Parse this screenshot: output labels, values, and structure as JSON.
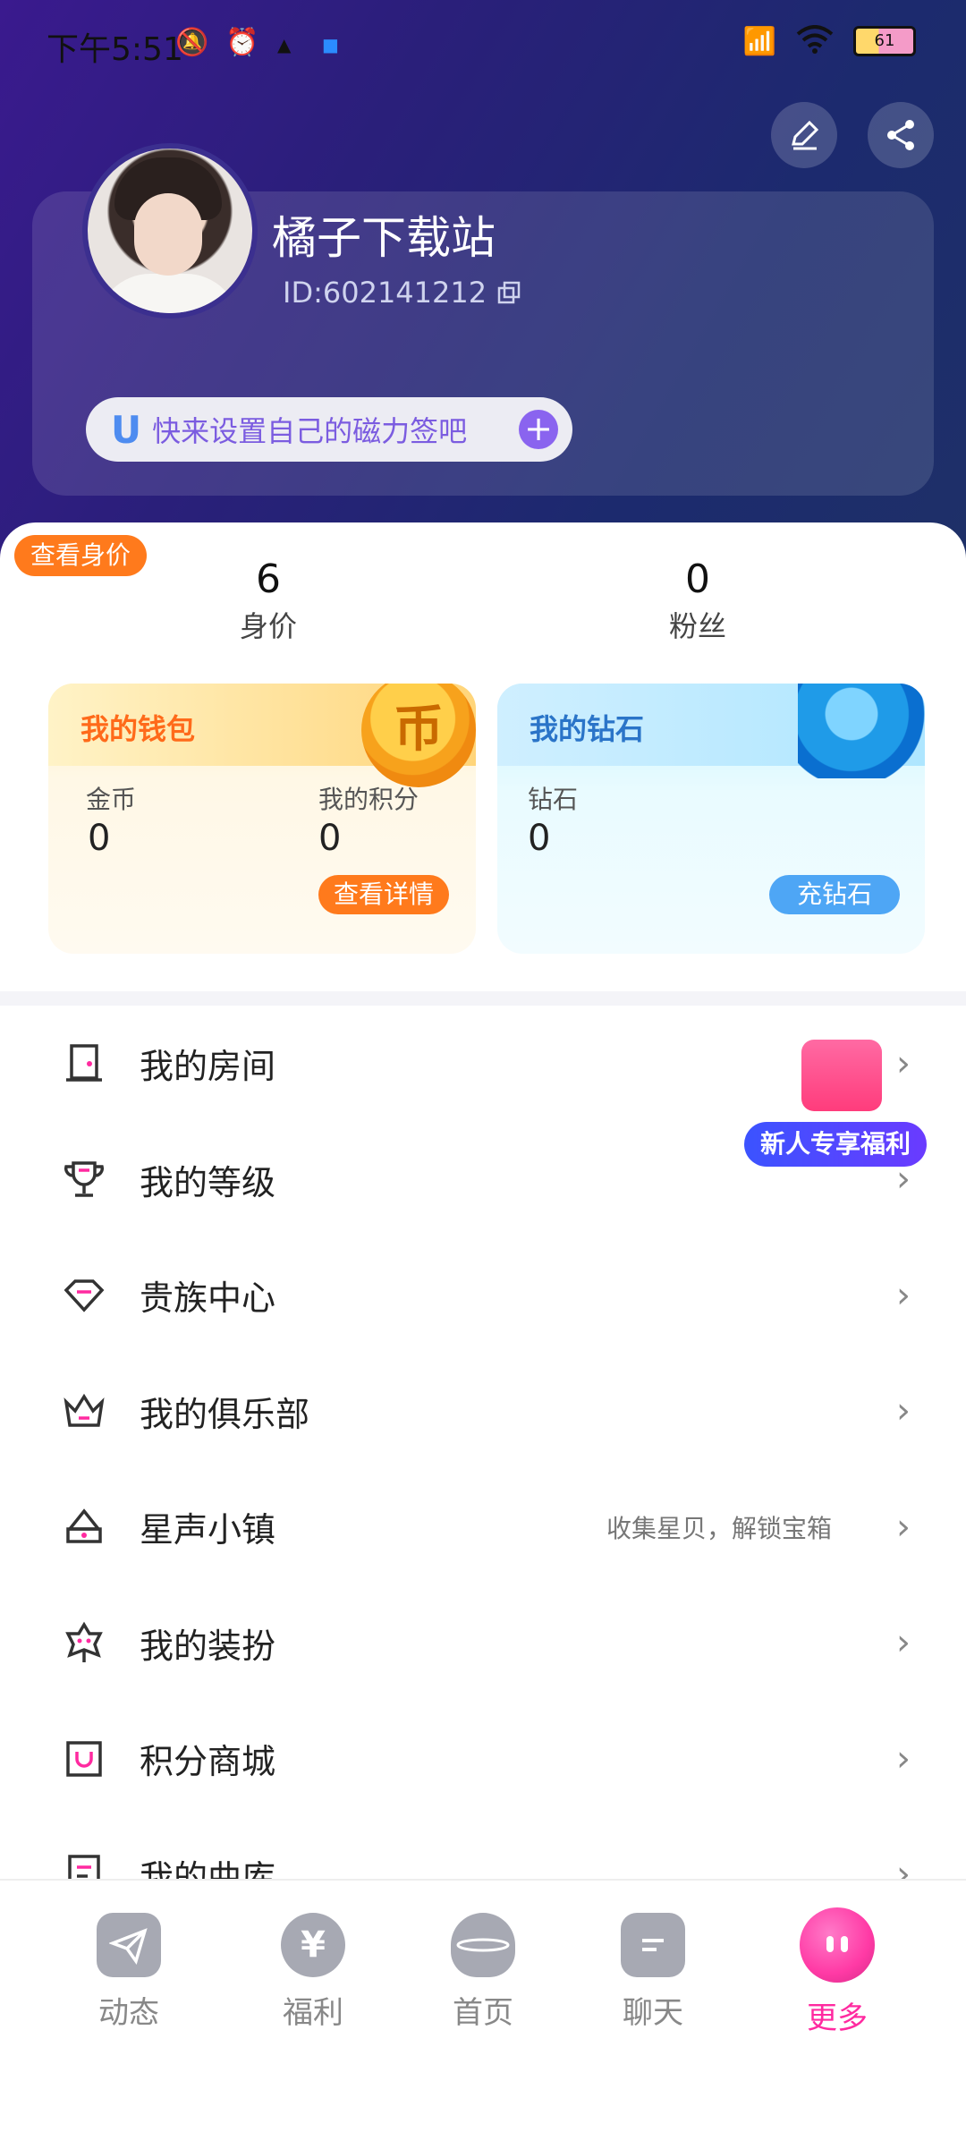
{
  "status_bar": {
    "time": "下午5:51",
    "battery": "61"
  },
  "profile": {
    "name": "橘子下载站",
    "id": "ID:602141212",
    "tagline": "快来设置自己的磁力签吧",
    "tagline_icon": "U"
  },
  "badge": "查看身价",
  "stats": [
    {
      "value": "6",
      "label": "身价"
    },
    {
      "value": "0",
      "label": "粉丝"
    }
  ],
  "wallet": {
    "title": "我的钱包",
    "coin_glyph": "币",
    "gold_label": "金币",
    "gold_value": "0",
    "points_label": "我的积分",
    "points_value": "0",
    "details_button": "查看详情"
  },
  "diamond": {
    "title": "我的钻石",
    "label": "钻石",
    "value": "0",
    "recharge_button": "充钻石"
  },
  "promo": {
    "text": "新人专享福利"
  },
  "menu": [
    {
      "label": "我的房间",
      "hint": "",
      "icon": "door-icon"
    },
    {
      "label": "我的等级",
      "hint": "",
      "icon": "trophy-icon"
    },
    {
      "label": "贵族中心",
      "hint": "",
      "icon": "gem-icon"
    },
    {
      "label": "我的俱乐部",
      "hint": "",
      "icon": "crown-icon"
    },
    {
      "label": "星声小镇",
      "hint": "收集星贝，解锁宝箱",
      "icon": "town-icon"
    },
    {
      "label": "我的装扮",
      "hint": "",
      "icon": "flower-icon"
    },
    {
      "label": "积分商城",
      "hint": "",
      "icon": "bag-icon"
    },
    {
      "label": "我的曲库",
      "hint": "",
      "icon": "music-list-icon"
    }
  ],
  "tabs": [
    {
      "label": "动态",
      "icon": "paper-plane-icon"
    },
    {
      "label": "福利",
      "icon": "yen-icon"
    },
    {
      "label": "首页",
      "icon": "planet-icon"
    },
    {
      "label": "聊天",
      "icon": "chat-icon"
    },
    {
      "label": "更多",
      "icon": "mascot-icon"
    }
  ],
  "colors": {
    "accent": "#ff2aa0",
    "orange": "#ff7a1c",
    "purple": "#8a64ef",
    "blue": "#4ea6f5"
  }
}
